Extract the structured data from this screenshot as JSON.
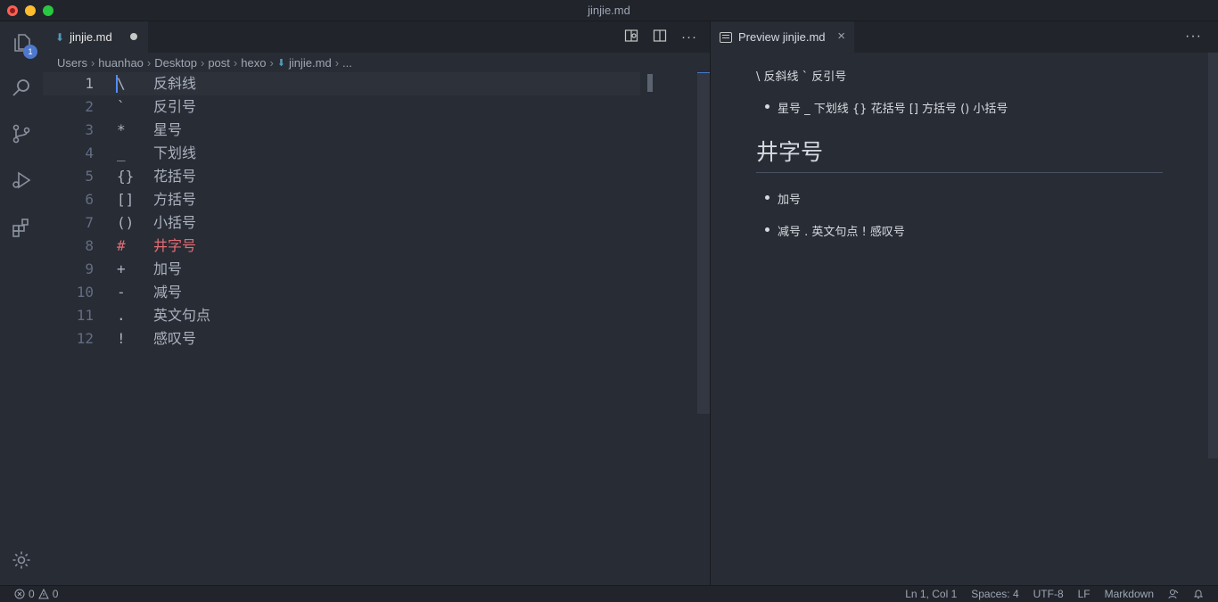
{
  "window": {
    "title": "jinjie.md"
  },
  "activity": {
    "explorer_badge": "1"
  },
  "editor": {
    "tab": {
      "label": "jinjie.md"
    },
    "breadcrumb": [
      "Users",
      "huanhao",
      "Desktop",
      "post",
      "hexo",
      "jinjie.md",
      "..."
    ],
    "lines": [
      {
        "num": "1",
        "sym": "\\",
        "text": "反斜线"
      },
      {
        "num": "2",
        "sym": "`",
        "text": "反引号"
      },
      {
        "num": "3",
        "sym": "*",
        "text": "星号"
      },
      {
        "num": "4",
        "sym": "_",
        "text": "下划线"
      },
      {
        "num": "5",
        "sym": "{}",
        "text": "花括号"
      },
      {
        "num": "6",
        "sym": "[]",
        "text": "方括号"
      },
      {
        "num": "7",
        "sym": "()",
        "text": "小括号"
      },
      {
        "num": "8",
        "sym": "#",
        "text": "井字号"
      },
      {
        "num": "9",
        "sym": "+",
        "text": "加号"
      },
      {
        "num": "10",
        "sym": "-",
        "text": "减号"
      },
      {
        "num": "11",
        "sym": ".",
        "text": "英文句点"
      },
      {
        "num": "12",
        "sym": "!",
        "text": "感叹号"
      }
    ]
  },
  "preview": {
    "tab": {
      "label": "Preview jinjie.md"
    },
    "paragraph": "\\ 反斜线 ` 反引号",
    "bullet1": "星号 _ 下划线 {} 花括号 [] 方括号 () 小括号",
    "heading": "井字号",
    "bullet2": "加号",
    "bullet3": "减号 . 英文句点 ! 感叹号"
  },
  "status": {
    "errors": "0",
    "warnings": "0",
    "position": "Ln 1, Col 1",
    "spaces": "Spaces: 4",
    "encoding": "UTF-8",
    "eol": "LF",
    "language": "Markdown"
  },
  "colors": {
    "accent": "#4d78cc",
    "heading": "#e06c75",
    "editor_bg": "#282c34",
    "chrome_bg": "#21252b"
  }
}
